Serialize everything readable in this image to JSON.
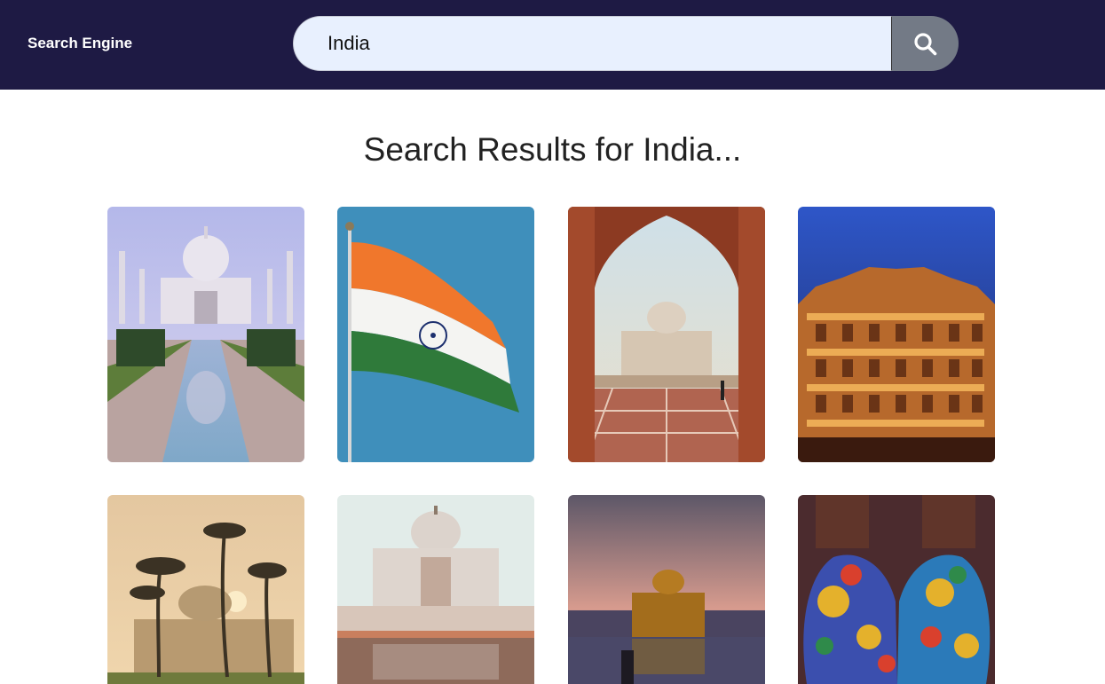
{
  "navbar": {
    "brand": "Search Engine"
  },
  "search": {
    "value": "India",
    "button_icon": "search-icon"
  },
  "results": {
    "title": "Search Results for India..."
  },
  "images": [
    {
      "subject": "taj-mahal-reflecting-pool"
    },
    {
      "subject": "indian-flag"
    },
    {
      "subject": "taj-mahal-through-arch"
    },
    {
      "subject": "hawa-mahal-night"
    },
    {
      "subject": "humayun-tomb-palms"
    },
    {
      "subject": "taj-mahal-closeup"
    },
    {
      "subject": "golden-temple-sunset"
    },
    {
      "subject": "holi-colored-hands"
    }
  ],
  "colors": {
    "navbar": "#1e1a44",
    "search_field": "#e8f0fe",
    "search_button": "#737a86"
  }
}
